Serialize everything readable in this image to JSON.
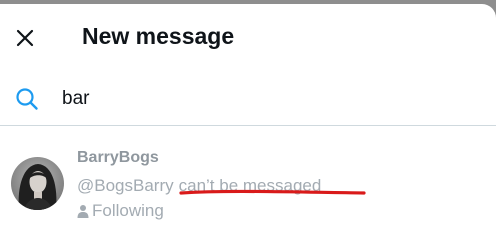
{
  "header": {
    "title": "New message",
    "close_icon": "close-icon"
  },
  "search": {
    "value": "bar",
    "icon": "search-icon",
    "accent_color": "#1d9bf0"
  },
  "results": [
    {
      "name": "BarryBogs",
      "handle": "@BogsBarry",
      "status": "can’t be messaged",
      "relationship": "Following",
      "relationship_icon": "person-icon"
    }
  ],
  "annotation": {
    "type": "red-underline",
    "color": "#d91a1a"
  }
}
